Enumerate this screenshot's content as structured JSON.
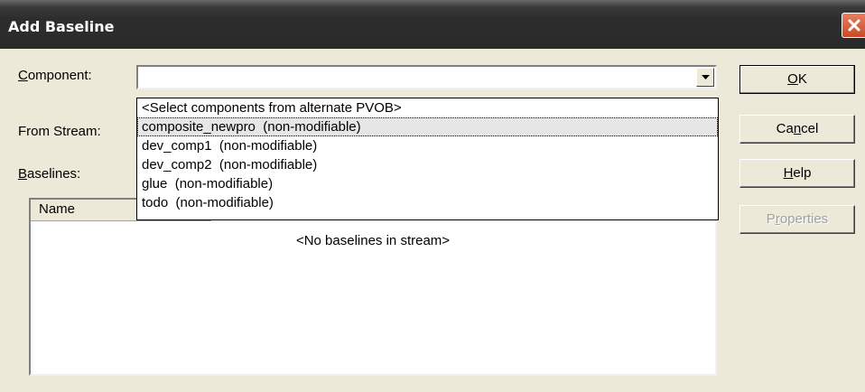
{
  "window": {
    "title": "Add Baseline",
    "close_icon": "close-icon"
  },
  "form": {
    "component_label": {
      "pre": "",
      "key": "C",
      "post": "omponent:"
    },
    "component_value": "",
    "from_stream_label": "From Stream:",
    "baselines_label": {
      "pre": "",
      "key": "B",
      "post": "aselines:"
    }
  },
  "dropdown": {
    "items": [
      "<Select components from alternate PVOB>",
      "composite_newpro  (non-modifiable)",
      "dev_comp1  (non-modifiable)",
      "dev_comp2  (non-modifiable)",
      "glue  (non-modifiable)",
      "todo  (non-modifiable)"
    ],
    "selected_index": 1
  },
  "baselines_list": {
    "column_header": "Name",
    "empty_message": "<No baselines in stream>"
  },
  "buttons": {
    "ok": {
      "pre": "",
      "key": "O",
      "post": "K"
    },
    "cancel": {
      "pre": "Ca",
      "key": "n",
      "post": "cel"
    },
    "help": {
      "pre": "",
      "key": "H",
      "post": "elp"
    },
    "properties": {
      "pre": "P",
      "key": "r",
      "post": "operties"
    }
  },
  "colors": {
    "titlebar": "#2d2d2d",
    "dialog_bg": "#ece9d8",
    "close_button": "#d9623a",
    "selection_bg": "#e6e6e6"
  }
}
